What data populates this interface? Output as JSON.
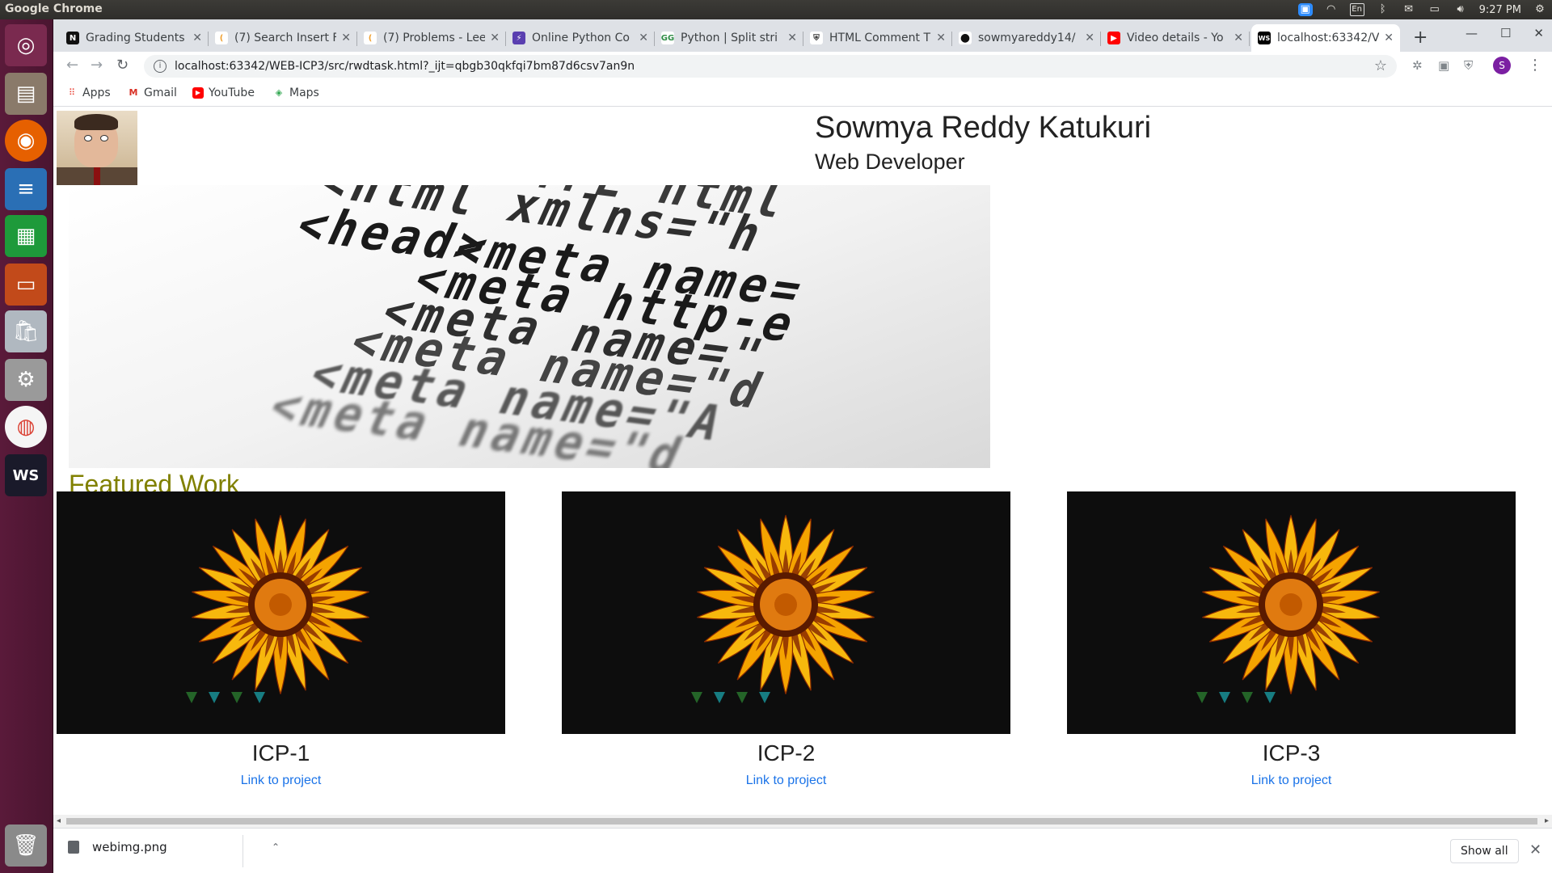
{
  "os": {
    "window_title": "Google Chrome",
    "tray": {
      "clock": "9:27 PM",
      "lang": "En"
    }
  },
  "launcher": {
    "apps": [
      "ubuntu-dash-icon",
      "files-icon",
      "firefox-icon",
      "writer-icon",
      "calc-icon",
      "impress-icon",
      "software-center-icon",
      "settings-icon",
      "chrome-icon",
      "webstorm-icon",
      "trash-icon"
    ]
  },
  "browser": {
    "tabs": [
      {
        "label": "Grading Students",
        "favicon": "N"
      },
      {
        "label": "(7) Search Insert F",
        "favicon": "("
      },
      {
        "label": "(7) Problems - Lee",
        "favicon": "("
      },
      {
        "label": "Online Python Co",
        "favicon": "⚡"
      },
      {
        "label": "Python | Split stri",
        "favicon": "GG"
      },
      {
        "label": "HTML Comment T",
        "favicon": "⛨"
      },
      {
        "label": "sowmyareddy14/",
        "favicon": "●"
      },
      {
        "label": "Video details - Yo",
        "favicon": "▶"
      },
      {
        "label": "localhost:63342/V",
        "favicon": "WS"
      }
    ],
    "url": "localhost:63342/WEB-ICP3/src/rwdtask.html?_ijt=qbgb30qkfqi7bm87d6csv7an9n",
    "profile_initial": "S",
    "bookmarks": [
      {
        "label": "Apps",
        "icon": "apps-grid-icon"
      },
      {
        "label": "Gmail",
        "icon": "gmail-icon"
      },
      {
        "label": "YouTube",
        "icon": "youtube-icon"
      },
      {
        "label": "Maps",
        "icon": "maps-icon"
      }
    ],
    "download": {
      "filename": "webimg.png",
      "show_all": "Show all"
    }
  },
  "page": {
    "name": "Sowmya Reddy Katukuri",
    "role": "Web Developer",
    "hero_code": [
      "<!DOCTYPE html",
      "<html xmlns=\"h",
      "<head>",
      "<meta name=",
      "<meta http-e",
      "<meta name=\"",
      "<meta name=\"d",
      "<meta name=\"A",
      "<meta name=\"d"
    ],
    "featured_heading": "Featured Work",
    "projects": [
      {
        "title": "ICP-1",
        "link": "Link to project"
      },
      {
        "title": "ICP-2",
        "link": "Link to project"
      },
      {
        "title": "ICP-3",
        "link": "Link to project"
      }
    ]
  },
  "colors": {
    "featured": "#808000",
    "link": "#1a73e8",
    "launcher": "#5a1a3a"
  }
}
